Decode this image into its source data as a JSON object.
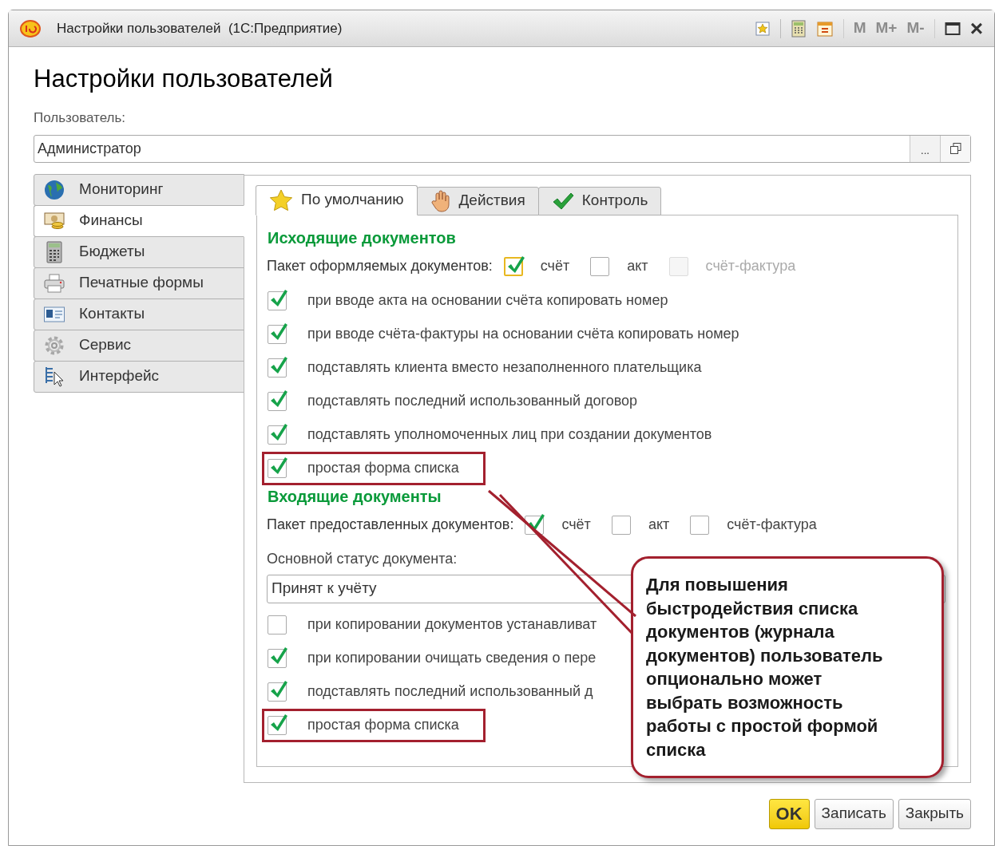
{
  "window": {
    "title": "Настройки пользователей  (1С:Предприятие)",
    "memory_buttons": [
      {
        "label": "M",
        "disabled": true
      },
      {
        "label": "M+",
        "disabled": true
      },
      {
        "label": "M-",
        "disabled": true
      }
    ],
    "close": "×"
  },
  "heading": "Настройки пользователей",
  "user_field": {
    "label": "Пользователь:",
    "value": "Администратор",
    "choose": "..."
  },
  "sections": [
    {
      "label": "Мониторинг",
      "kind": "globe",
      "selected": false
    },
    {
      "label": "Финансы",
      "kind": "money",
      "selected": true
    },
    {
      "label": "Бюджеты",
      "kind": "calculator",
      "selected": false
    },
    {
      "label": "Печатные формы",
      "kind": "printer",
      "selected": false
    },
    {
      "label": "Контакты",
      "kind": "card",
      "selected": false
    },
    {
      "label": "Сервис",
      "kind": "gear",
      "selected": false
    },
    {
      "label": "Интерфейс",
      "kind": "pointer",
      "selected": false
    }
  ],
  "tabs": [
    {
      "label": "По умолчанию",
      "kind": "star",
      "selected": true
    },
    {
      "label": "Действия",
      "kind": "hand",
      "selected": false
    },
    {
      "label": "Контроль",
      "kind": "check",
      "selected": false
    }
  ],
  "outgoing": {
    "heading": "Исходящие документов",
    "package_label": "Пакет оформляемых документов:",
    "package_options": [
      {
        "label": "счёт",
        "checked": true,
        "disabled": false,
        "focused": true
      },
      {
        "label": "акт",
        "checked": false,
        "disabled": false,
        "focused": false
      },
      {
        "label": "счёт-фактура",
        "checked": false,
        "disabled": true,
        "focused": false
      }
    ],
    "options": [
      {
        "label": "при вводе акта на основании счёта копировать номер",
        "checked": true,
        "highlighted": false
      },
      {
        "label": "при вводе счёта-фактуры на основании счёта копировать номер",
        "checked": true,
        "highlighted": false
      },
      {
        "label": "подставлять клиента вместо незаполненного плательщика",
        "checked": true,
        "highlighted": false
      },
      {
        "label": "подставлять последний использованный договор",
        "checked": true,
        "highlighted": false
      },
      {
        "label": "подставлять уполномоченных лиц при создании документов",
        "checked": true,
        "highlighted": false
      },
      {
        "label": "простая форма списка",
        "checked": true,
        "highlighted": true
      }
    ]
  },
  "incoming": {
    "heading": "Входящие документы",
    "package_label": "Пакет предоставленных документов:",
    "package_options": [
      {
        "label": "счёт",
        "checked": true,
        "disabled": false
      },
      {
        "label": "акт",
        "checked": false,
        "disabled": false
      },
      {
        "label": "счёт-фактура",
        "checked": false,
        "disabled": false
      }
    ],
    "status_label": "Основной статус документа:",
    "status_value": "Принят к учёту",
    "options": [
      {
        "label": "при копировании документов устанавливат",
        "checked": false,
        "highlighted": false
      },
      {
        "label": "при копировании очищать сведения о пере",
        "checked": true,
        "highlighted": false
      },
      {
        "label": "подставлять последний использованный д",
        "checked": true,
        "highlighted": false
      },
      {
        "label": "простая форма списка",
        "checked": true,
        "highlighted": true
      }
    ]
  },
  "callout": "Для повышения быстродействия списка документов (журнала документов) пользователь опционально может выбрать возможность работы с простой формой списка",
  "buttons": [
    {
      "label": "OK",
      "kind": "primary"
    },
    {
      "label": "Записать",
      "kind": "default"
    },
    {
      "label": "Закрыть",
      "kind": "default"
    }
  ]
}
